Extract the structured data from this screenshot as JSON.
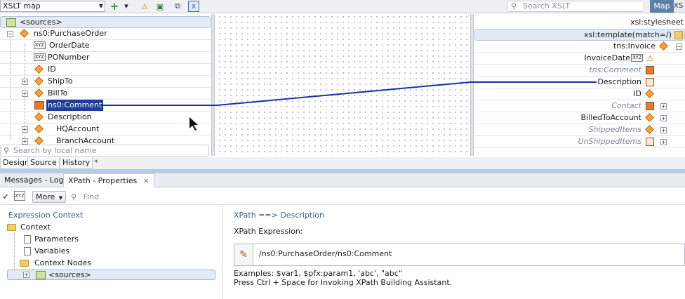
{
  "toolbar": {
    "map_type": "XSLT map",
    "search_placeholder": "Search XSLT",
    "map_button": "Map",
    "xsl_button": "XS"
  },
  "source_tree": {
    "root": "<sources>",
    "items": [
      {
        "label": "ns0:PurchaseOrder"
      },
      {
        "label": "OrderDate"
      },
      {
        "label": "PONumber"
      },
      {
        "label": "ID"
      },
      {
        "label": "ShipTo"
      },
      {
        "label": "BillTo"
      },
      {
        "label": "ns0:Comment"
      },
      {
        "label": "Description"
      },
      {
        "label": "HQAccount"
      },
      {
        "label": "BranchAccount"
      }
    ],
    "search_placeholder": "Search by local name"
  },
  "editor_tabs": [
    "Design",
    "Source",
    "History"
  ],
  "target_tree": {
    "items": [
      {
        "label": "xsl:stylesheet"
      },
      {
        "label": "xsl:template(match=/)"
      },
      {
        "label": "tns:Invoice"
      },
      {
        "label": "InvoiceDate"
      },
      {
        "label": "tns:Comment"
      },
      {
        "label": "Description"
      },
      {
        "label": "ID"
      },
      {
        "label": "Contact"
      },
      {
        "label": "BilledToAccount"
      },
      {
        "label": "ShippedItems"
      },
      {
        "label": "UnShippedItems"
      }
    ]
  },
  "bottom_tabs": {
    "messages": "Messages - Log",
    "properties": "XPath - Properties",
    "close": "×"
  },
  "bottom_toolbar": {
    "more": "More",
    "find_placeholder": "Find"
  },
  "expression_context": {
    "title": "Expression Context",
    "context": "Context",
    "parameters": "Parameters",
    "variables": "Variables",
    "context_nodes": "Context Nodes",
    "sources": "<sources>"
  },
  "xpath": {
    "title": "XPath ==> Description",
    "label": "XPath Expression:",
    "value": "/ns0:PurchaseOrder/ns0:Comment",
    "examples": "Examples: $var1, $pfx:param1, 'abc', \"abc\"",
    "hint": "Press Ctrl + Space for Invoking XPath Building Assistant."
  },
  "colors": {
    "accent": "#5d7fa8",
    "selection": "#1e3d9a",
    "mapping_line": "#1a2fa8"
  }
}
